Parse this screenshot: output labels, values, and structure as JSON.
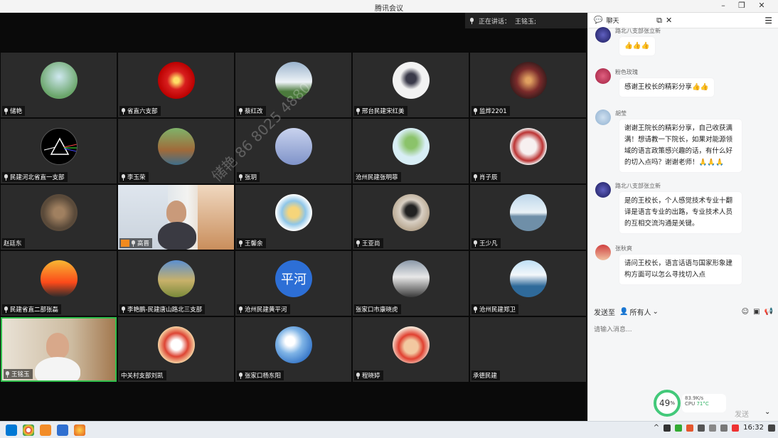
{
  "window": {
    "title": "腾讯会议"
  },
  "speaker": {
    "prefix": "正在讲话：",
    "name": "王铭玉;"
  },
  "watermark": "储艳 86 8025 4880",
  "tiles": [
    {
      "label": "储艳"
    },
    {
      "label": "省直六支部"
    },
    {
      "label": "蔡红改"
    },
    {
      "label": "邢台民建宋红美"
    },
    {
      "label": "监烨2201"
    },
    {
      "label": "民建河北省直一支部"
    },
    {
      "label": "李玉荣"
    },
    {
      "label": "张玥"
    },
    {
      "label": "沧州民建张明菲"
    },
    {
      "label": "肖子辰"
    },
    {
      "label": "赵廷东"
    },
    {
      "label": "高晋"
    },
    {
      "label": "王馨余"
    },
    {
      "label": "王亚尚"
    },
    {
      "label": "王少凡"
    },
    {
      "label": "民建省直二部张磊"
    },
    {
      "label": "李艳鹏-民建唐山路北三支部"
    },
    {
      "label": "沧州民建黄平河",
      "avatar_text": "平河"
    },
    {
      "label": "张家口市康晓虎"
    },
    {
      "label": "沧州民建郑卫"
    },
    {
      "label": "王铭玉"
    },
    {
      "label": "中关村支部刘凯"
    },
    {
      "label": "张家口杨东阳"
    },
    {
      "label": "程晓婷"
    },
    {
      "label": "承德民建"
    }
  ],
  "chat": {
    "title": "聊天",
    "messages": [
      {
        "name": "路北八支部张立新",
        "text": "👍👍👍"
      },
      {
        "name": "粉色玫瑰",
        "text": "感谢王校长的精彩分享👍👍"
      },
      {
        "name": "胡莹",
        "text": "谢谢王院长的精彩分享，自己收获满满！想请教一下院长，如果对能源领域的语言政策感兴趣的话，有什么好的切入点吗？谢谢老师！🙏🙏🙏"
      },
      {
        "name": "路北八支部张立新",
        "text": "是的王校长，个人感觉技术专业十翻译是语言专业的出路，专业技术人员的互相交流沟通是关键。"
      },
      {
        "name": "张秋爽",
        "text": "请问王校长，语言话语与国家形象建构方面可以怎么寻找切入点"
      }
    ],
    "send_to_label": "发送至",
    "recipient": "所有人",
    "input_placeholder": "请输入消息...",
    "send_label": "发送"
  },
  "cpu": {
    "percent": "49",
    "unit": "%",
    "net": "83.9K/s",
    "cpu_label": "CPU",
    "temp": "71°C"
  },
  "clock": "16:32",
  "colors": {
    "active_border": "#2fbf4b",
    "stage_bg": "#0a0a0a",
    "tile_bg": "#2b2b2b",
    "chat_bg": "#f5f6f7"
  }
}
